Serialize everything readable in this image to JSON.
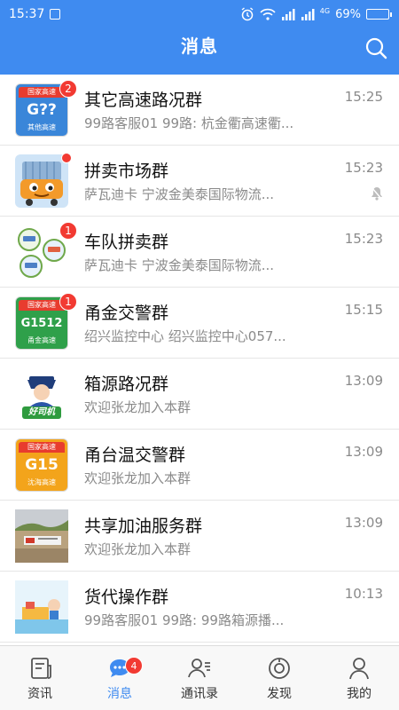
{
  "status_bar": {
    "time": "15:37",
    "battery": "69%",
    "battery_level": 0.69,
    "net_label": "4G"
  },
  "header": {
    "title": "消息"
  },
  "messages": [
    {
      "name": "其它高速路况群",
      "preview": "99路客服01  99路: 杭金衢高速衢...",
      "time": "15:25",
      "badge": "2",
      "avatar_type": "sign",
      "sign_top": "国家高速",
      "sign_code": "G??",
      "sign_bottom": "其他高速",
      "sign_color": "#3a86d9"
    },
    {
      "name": "拼卖市场群",
      "preview": "萨瓦迪卡  宁波金美泰国际物流...",
      "time": "15:23",
      "dot": true,
      "muted": true,
      "avatar_type": "truck"
    },
    {
      "name": "车队拼卖群",
      "preview": "萨瓦迪卡  宁波金美泰国际物流...",
      "time": "15:23",
      "badge": "1",
      "avatar_type": "circles"
    },
    {
      "name": "甬金交警群",
      "preview": "绍兴监控中心  绍兴监控中心057...",
      "time": "15:15",
      "badge": "1",
      "avatar_type": "sign",
      "sign_top": "国家高速",
      "sign_code": "G1512",
      "sign_bottom": "甬金高速",
      "sign_color": "#2fa04a"
    },
    {
      "name": "箱源路况群",
      "preview": "欢迎张龙加入本群",
      "time": "13:09",
      "avatar_type": "driver",
      "avatar_text": "好司机"
    },
    {
      "name": "甬台温交警群",
      "preview": "欢迎张龙加入本群",
      "time": "13:09",
      "avatar_type": "sign",
      "sign_top": "国家高速",
      "sign_code": "G15",
      "sign_bottom": "沈海高速",
      "sign_color": "#f3a41b"
    },
    {
      "name": "共享加油服务群",
      "preview": "欢迎张龙加入本群",
      "time": "13:09",
      "avatar_type": "photo"
    },
    {
      "name": "货代操作群",
      "preview": "99路客服01  99路: 99路箱源播...",
      "time": "10:13",
      "avatar_type": "cartoon"
    }
  ],
  "tabs": [
    {
      "label": "资讯",
      "icon": "news-icon"
    },
    {
      "label": "消息",
      "icon": "chat-icon",
      "badge": "4",
      "active": true
    },
    {
      "label": "通讯录",
      "icon": "contacts-icon"
    },
    {
      "label": "发现",
      "icon": "discover-icon"
    },
    {
      "label": "我的",
      "icon": "profile-icon"
    }
  ],
  "colors": {
    "accent": "#3f8bf0",
    "badge": "#f23a32"
  }
}
